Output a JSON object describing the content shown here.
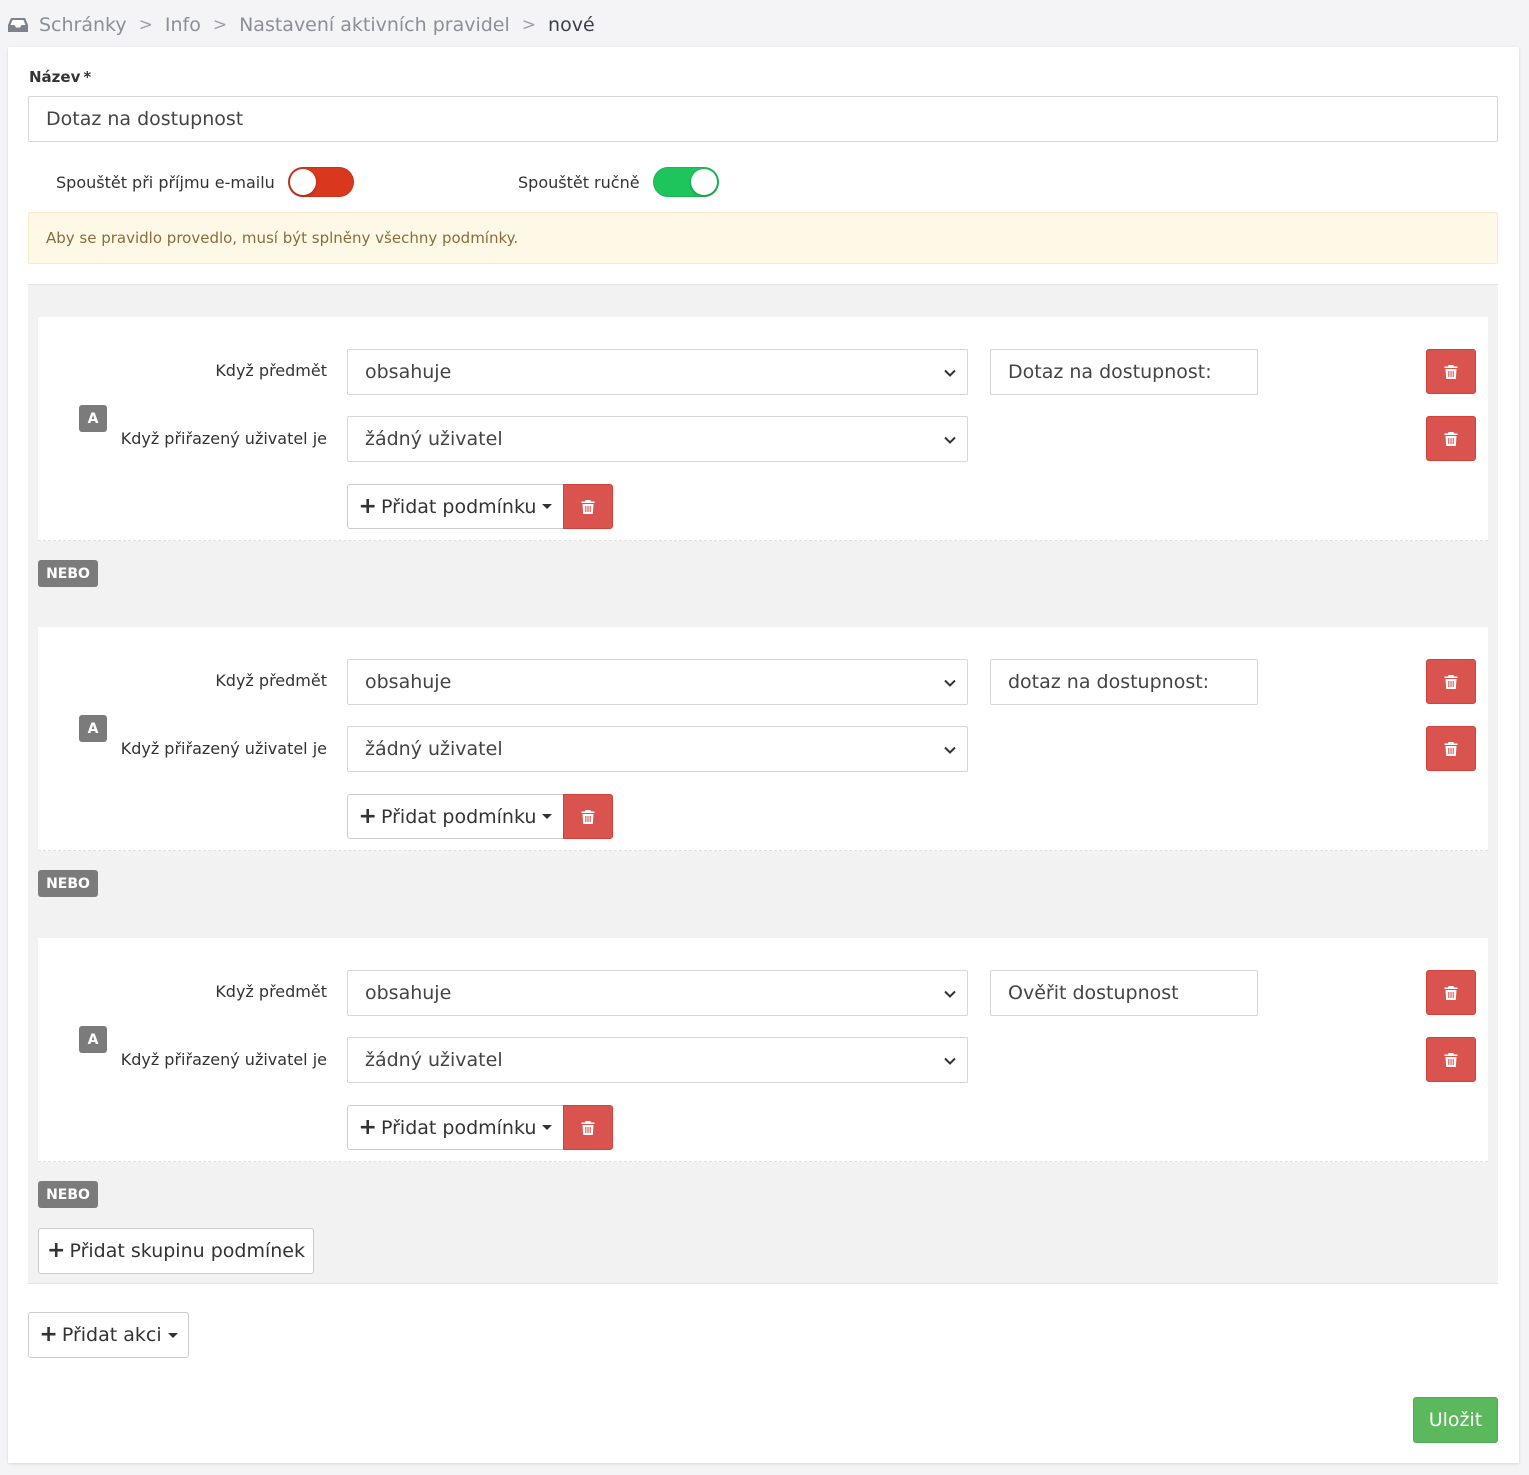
{
  "breadcrumb": {
    "items": [
      "Schránky",
      "Info",
      "Nastavení aktivních pravidel"
    ],
    "current": "nové",
    "separator": ">"
  },
  "form": {
    "name_label": "Název",
    "required_mark": "*",
    "name_value": "Dotaz na dostupnost",
    "toggle_email_label": "Spouštět při příjmu e-mailu",
    "toggle_email_state": "off",
    "toggle_manual_label": "Spouštět ručně",
    "toggle_manual_state": "on",
    "alert_text": "Aby se pravidlo provedlo, musí být splněny všechny podmínky."
  },
  "groups": [
    {
      "and_badge": "A",
      "subject_label": "Když předmět",
      "subject_operator": "obsahuje",
      "subject_value": "Dotaz na dostupnost:",
      "user_label": "Když přiřazený uživatel je",
      "user_value": "žádný uživatel",
      "add_condition_label": "Přidat podmínku",
      "or_badge": "NEBO"
    },
    {
      "and_badge": "A",
      "subject_label": "Když předmět",
      "subject_operator": "obsahuje",
      "subject_value": "dotaz na dostupnost:",
      "user_label": "Když přiřazený uživatel je",
      "user_value": "žádný uživatel",
      "add_condition_label": "Přidat podmínku",
      "or_badge": "NEBO"
    },
    {
      "and_badge": "A",
      "subject_label": "Když předmět",
      "subject_operator": "obsahuje",
      "subject_value": "Ověřit dostupnost",
      "user_label": "Když přiřazený uživatel je",
      "user_value": "žádný uživatel",
      "add_condition_label": "Přidat podmínku",
      "or_badge": "NEBO"
    }
  ],
  "actions": {
    "add_group_label": "Přidat skupinu podmínek",
    "add_action_label": "Přidat akci",
    "save_label": "Uložit"
  },
  "colors": {
    "danger": "#d9534f",
    "success": "#5cb85c",
    "toggle_on": "#1ec55c",
    "toggle_off": "#d9381e",
    "alert_bg": "#fef9e7",
    "alert_text": "#8a6d3b"
  }
}
